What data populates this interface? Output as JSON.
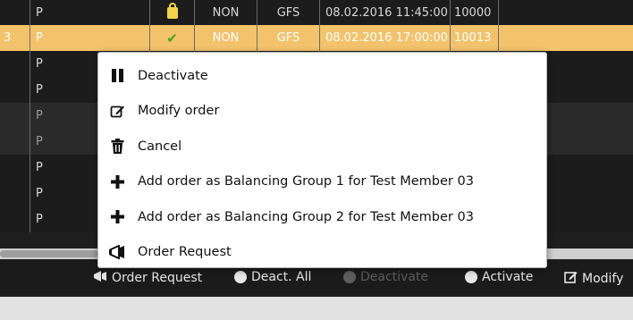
{
  "grid": {
    "rows": [
      {
        "c0": "",
        "c1": "P",
        "status": "lock",
        "c3": "NON",
        "c4": "GFS",
        "c5": "08.02.2016 11:45:00",
        "c6": "10000",
        "style": "dark"
      },
      {
        "c0": "3",
        "c1": "P",
        "status": "check",
        "c3": "NON",
        "c4": "GFS",
        "c5": "08.02.2016 17:00:00",
        "c6": "10013",
        "style": "sel"
      },
      {
        "c0": "",
        "c1": "P",
        "status": "",
        "c3": "",
        "c4": "",
        "c5": "",
        "c6": "",
        "style": "dark"
      },
      {
        "c0": "",
        "c1": "P",
        "status": "",
        "c3": "",
        "c4": "",
        "c5": "",
        "c6": "",
        "style": "dark"
      },
      {
        "c0": "",
        "c1": "P",
        "status": "",
        "c3": "",
        "c4": "",
        "c5": "",
        "c6": "",
        "style": "mid"
      },
      {
        "c0": "",
        "c1": "P",
        "status": "",
        "c3": "",
        "c4": "",
        "c5": "",
        "c6": "",
        "style": "mid"
      },
      {
        "c0": "",
        "c1": "P",
        "status": "",
        "c3": "",
        "c4": "",
        "c5": "",
        "c6": "",
        "style": "dark"
      },
      {
        "c0": "",
        "c1": "P",
        "status": "",
        "c3": "",
        "c4": "",
        "c5": "",
        "c6": "",
        "style": "dark"
      },
      {
        "c0": "",
        "c1": "P",
        "status": "",
        "c3": "",
        "c4": "",
        "c5": "",
        "c6": "",
        "style": "dark"
      }
    ]
  },
  "context_menu": {
    "items": [
      {
        "label": "Deactivate",
        "icon": "pause-icon"
      },
      {
        "label": "Modify order",
        "icon": "edit-icon"
      },
      {
        "label": "Cancel",
        "icon": "trash-icon"
      },
      {
        "label": "Add order as Balancing Group 1 for Test Member 03",
        "icon": "plus-icon"
      },
      {
        "label": "Add order as Balancing Group 2 for Test Member 03",
        "icon": "plus-icon"
      },
      {
        "label": "Order Request",
        "icon": "megaphone-icon"
      }
    ]
  },
  "toolbar": {
    "order_request": "Order Request",
    "deact_all": "Deact. All",
    "deactivate": "Deactivate",
    "activate": "Activate",
    "modify": "Modify"
  },
  "colors": {
    "selected_row": "#f3c36c",
    "grid_bg": "#1e1e1e",
    "check": "#3fa320",
    "lock": "#f2d34a"
  }
}
